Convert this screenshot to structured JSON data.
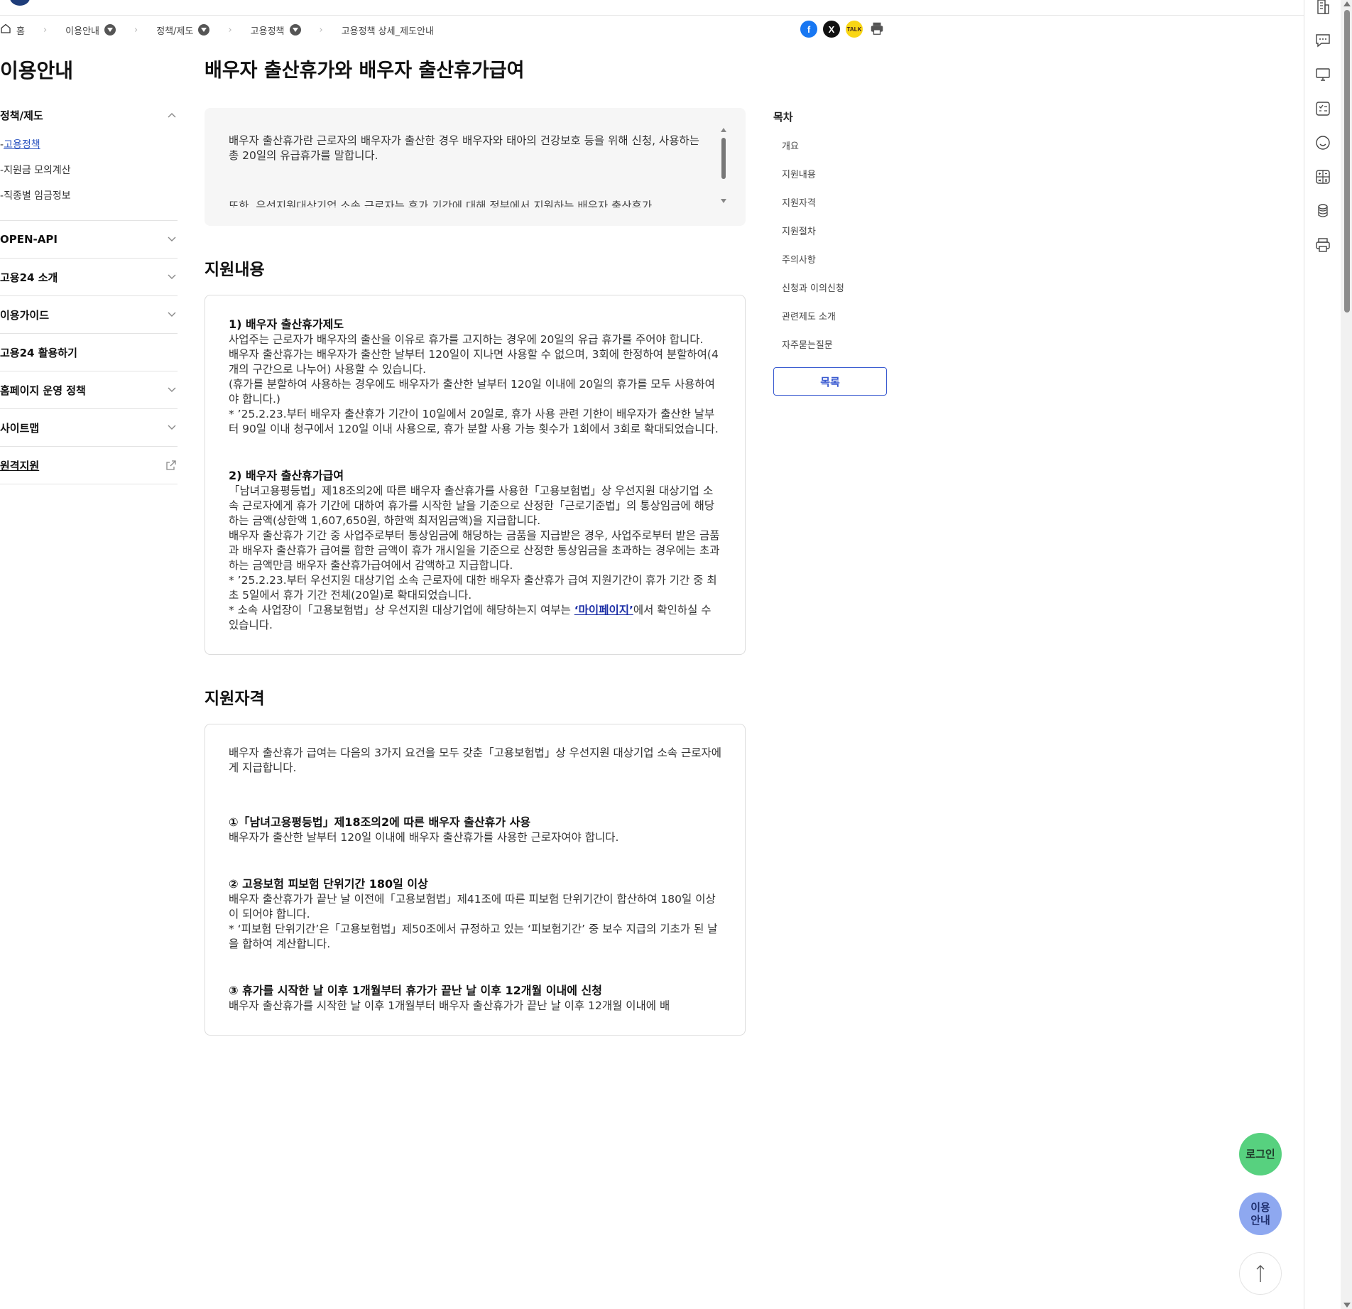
{
  "breadcrumb": {
    "home": "홈",
    "items": [
      "이용안내",
      "정책/제도",
      "고용정책",
      "고용정책 상세_제도안내"
    ]
  },
  "share": {
    "facebook": "f",
    "x": "X",
    "kakao": "TALK"
  },
  "lnb": {
    "title": "이용안내",
    "groups": [
      {
        "label": "정책/제도",
        "sub": [
          "고용정책",
          "지원금 모의계산",
          "직종별 임금정보"
        ]
      },
      {
        "label": "OPEN-API"
      },
      {
        "label": "고용24 소개"
      },
      {
        "label": "이용가이드"
      },
      {
        "label": "고용24 활용하기"
      },
      {
        "label": "홈페이지 운영 정책"
      },
      {
        "label": "사이트맵"
      },
      {
        "label": "원격지원"
      }
    ]
  },
  "main": {
    "title": "배우자 출산휴가와 배우자 출산휴가급여",
    "overview": "배우자 출산휴가란 근로자의 배우자가 출산한 경우 배우자와 태아의 건강보호 등을 위해 신청, 사용하는 총 20일의 유급휴가를 말합니다.",
    "overview_cut": "또한, 우선지원대상기업 소속 근로자는 휴가 기간에 대해 정부에서 지원하는 배우자 출산휴가",
    "section1": {
      "title": "지원내용",
      "h1": "1) 배우자 출산휴가제도",
      "p1": "사업주는 근로자가 배우자의 출산을 이유로 휴가를 고지하는 경우에 20일의 유급 휴가를 주어야 합니다.",
      "p2": "배우자 출산휴가는 배우자가 출산한 날부터 120일이 지나면 사용할 수 없으며, 3회에 한정하여 분할하여(4개의 구간으로 나누어) 사용할 수 있습니다.",
      "p3": "(휴가를 분할하여 사용하는 경우에도 배우자가 출산한 날부터 120일 이내에 20일의 휴가를 모두 사용하여야 합니다.)",
      "p4": "* ’25.2.23.부터 배우자 출산휴가 기간이 10일에서 20일로, 휴가 사용 관련 기한이 배우자가 출산한 날부터 90일 이내 청구에서 120일 이내 사용으로, 휴가 분할 사용 가능 횟수가 1회에서 3회로 확대되었습니다.",
      "h2": "2) 배우자 출산휴가급여",
      "p5": "「남녀고용평등법」제18조의2에 따른 배우자 출산휴가를 사용한「고용보험법」상 우선지원 대상기업 소속 근로자에게 휴가 기간에 대하여 휴가를 시작한 날을 기준으로 산정한「근로기준법」의 통상임금에 해당하는 금액(상한액 1,607,650원, 하한액 최저임금액)을 지급합니다.",
      "p6": "배우자 출산휴가 기간 중 사업주로부터 통상임금에 해당하는 금품을 지급받은 경우, 사업주로부터 받은 금품과 배우자 출산휴가 급여를 합한 금액이 휴가 개시일을 기준으로 산정한 통상임금을 초과하는 경우에는 초과하는 금액만큼 배우자 출산휴가급여에서 감액하고 지급합니다.",
      "p7": "* ’25.2.23.부터 우선지원 대상기업 소속 근로자에 대한 배우자 출산휴가 급여 지원기간이 휴가 기간 중 최초 5일에서 휴가 기간 전체(20일)로 확대되었습니다.",
      "p8_pre": "* 소속 사업장이「고용보험법」상 우선지원 대상기업에 해당하는지 여부는 ",
      "p8_link": "‘마이페이지’",
      "p8_post": "에서 확인하실 수 있습니다."
    },
    "section2": {
      "title": "지원자격",
      "p1": "배우자 출산휴가 급여는 다음의 3가지 요건을 모두 갖춘「고용보험법」상 우선지원 대상기업 소속 근로자에게 지급합니다.",
      "h1": "①「남녀고용평등법」제18조의2에 따른 배우자 출산휴가 사용",
      "p2": "배우자가 출산한 날부터 120일 이내에 배우자 출산휴가를 사용한 근로자여야 합니다.",
      "h2": "② 고용보험 피보험 단위기간 180일 이상",
      "p3": "배우자 출산휴가가 끝난 날 이전에「고용보험법」제41조에 따른 피보험 단위기간이 합산하여 180일 이상이 되어야 합니다.",
      "p4": "* ‘피보험 단위기간’은「고용보험법」제50조에서 규정하고 있는 ‘피보험기간’ 중 보수 지급의 기초가 된 날을 합하여 계산합니다.",
      "h3": "③ 휴가를 시작한 날 이후 1개월부터 휴가가 끝난 날 이후 12개월 이내에 신청",
      "p5": "배우자 출산휴가를 시작한 날 이후 1개월부터 배우자 출산휴가가 끝난 날 이후 12개월 이내에 배"
    }
  },
  "toc": {
    "title": "목차",
    "items": [
      "개요",
      "지원내용",
      "지원자격",
      "지원절차",
      "주의사항",
      "신청과 이의신청",
      "관련제도 소개",
      "자주묻는질문"
    ],
    "button": "목록"
  },
  "fab": {
    "login": "로그인",
    "guide_line1": "이용",
    "guide_line2": "안내"
  },
  "colors": {
    "accent": "#3a5bd0",
    "login_fab": "#57d17f",
    "guide_fab": "#8ea8f0",
    "active_link": "#2a53c0"
  }
}
